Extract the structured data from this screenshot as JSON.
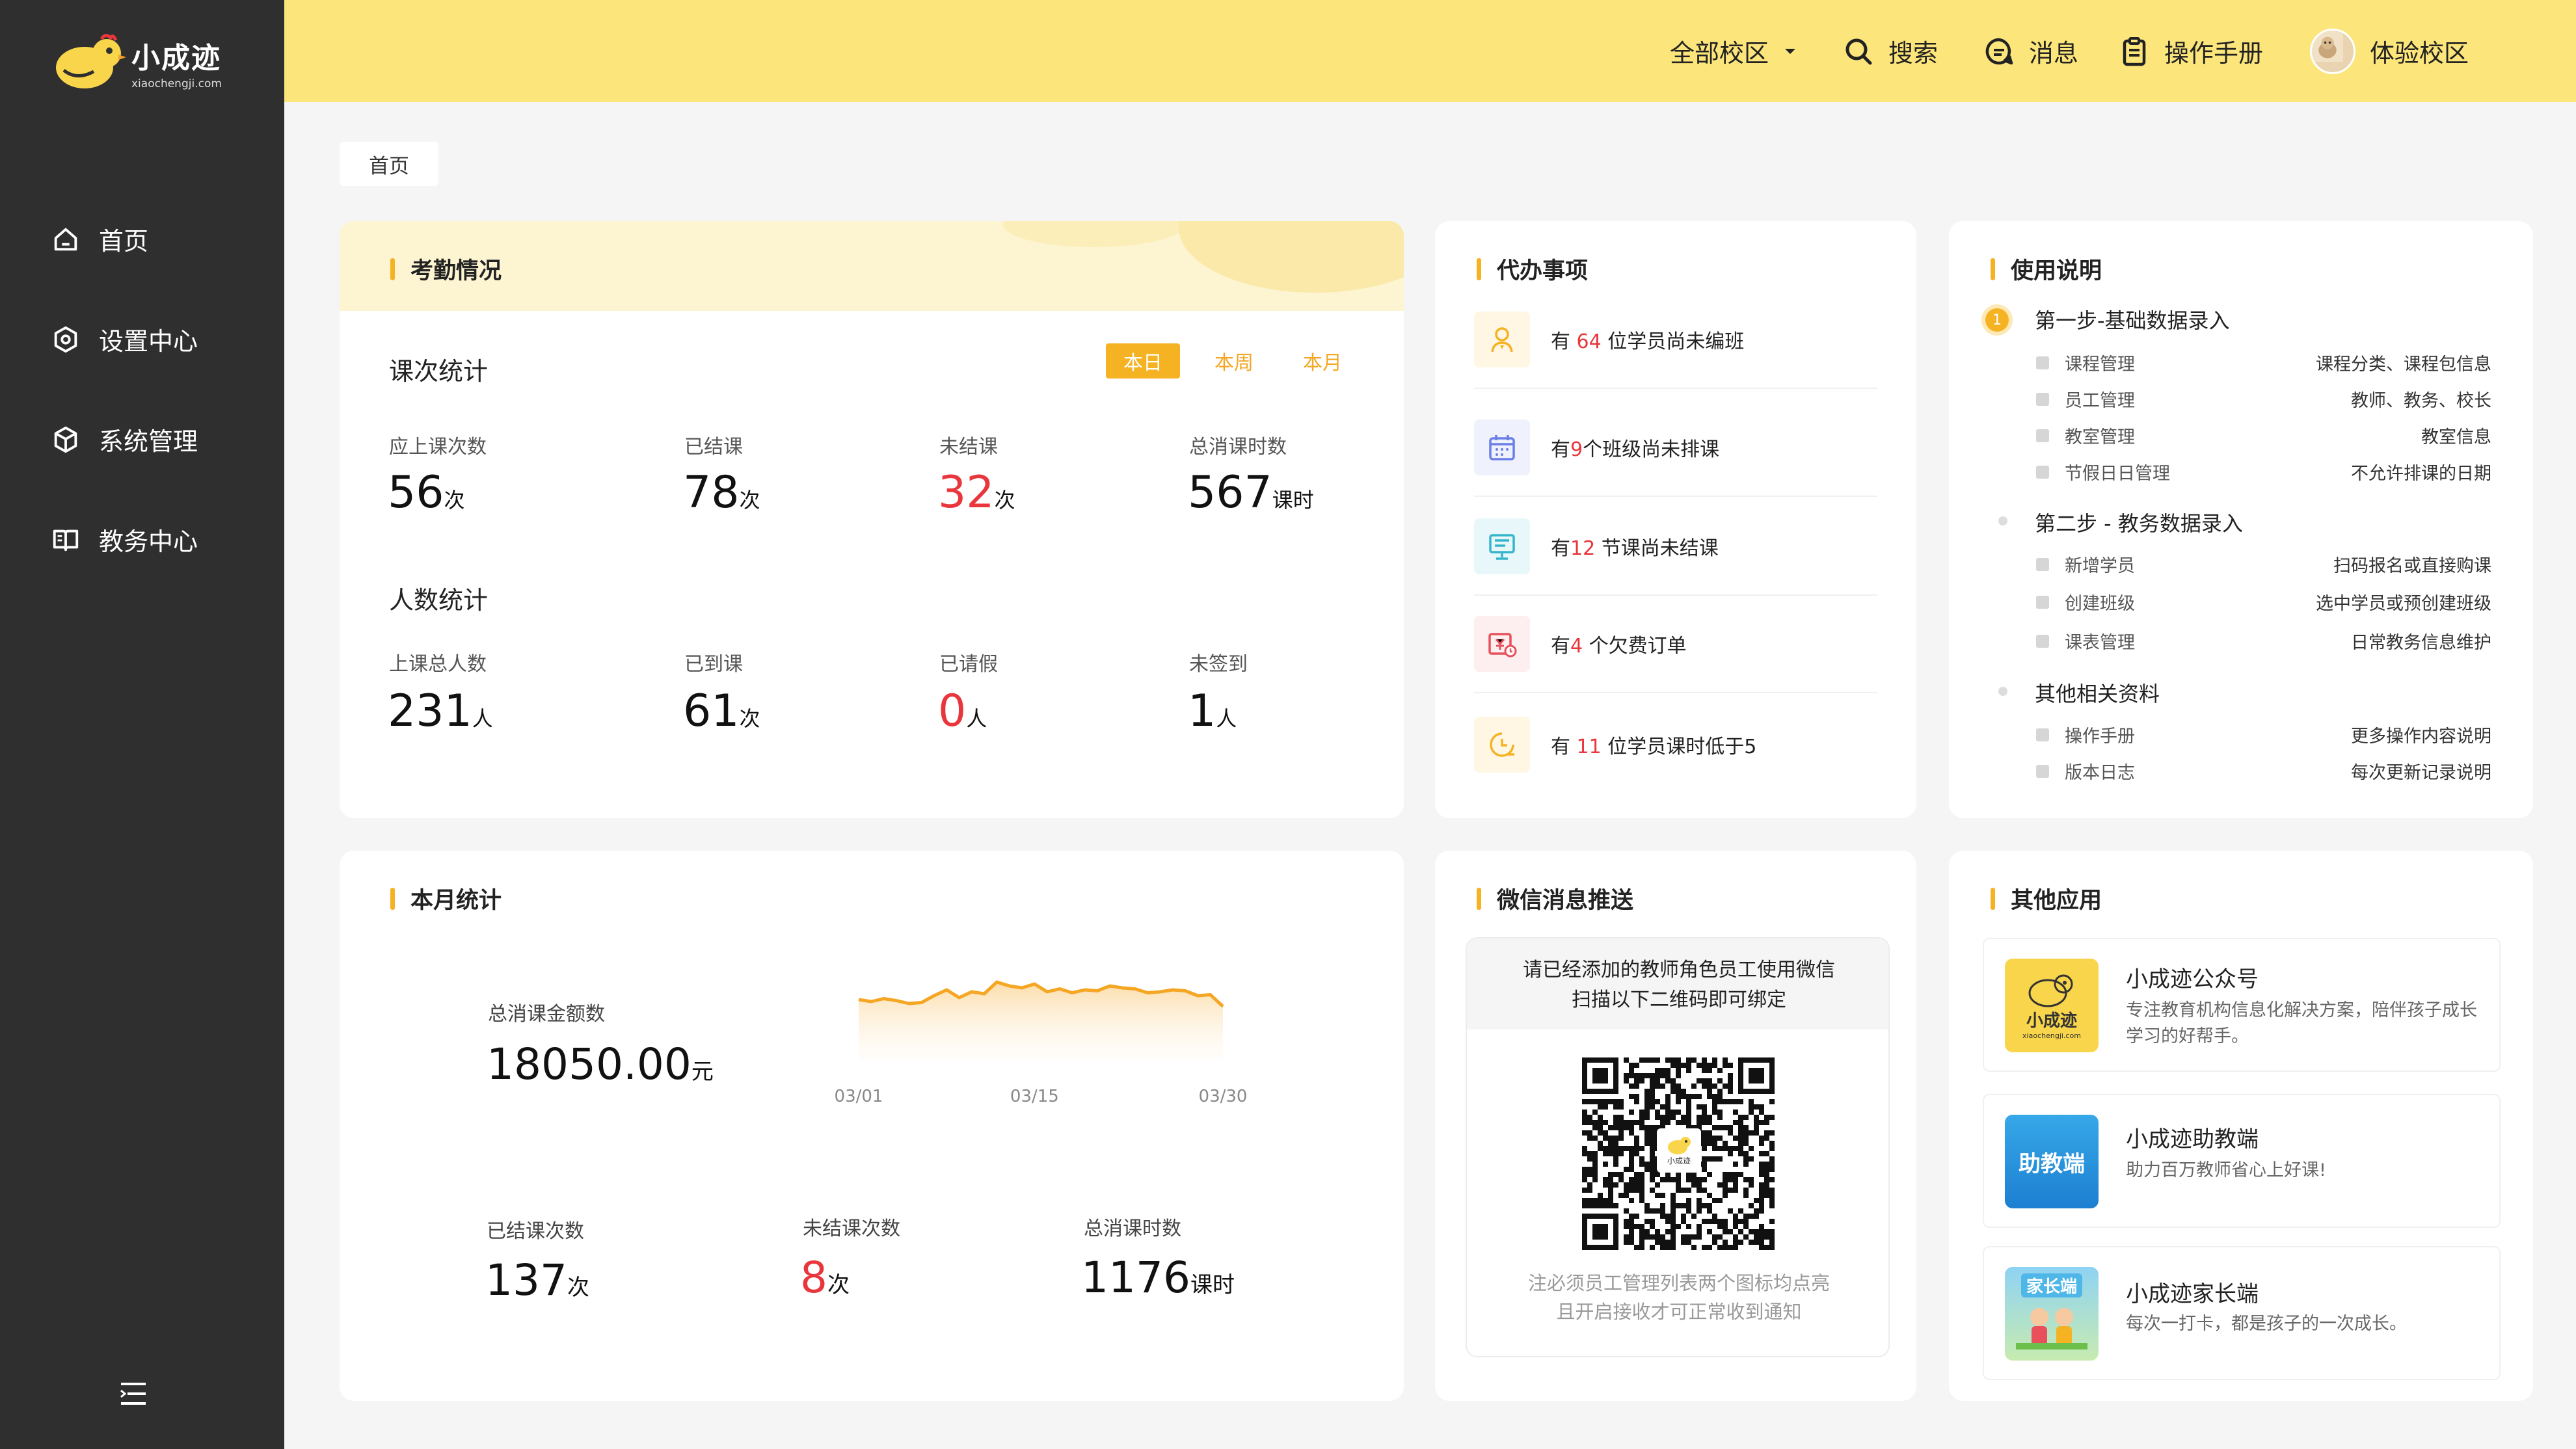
{
  "brand": {
    "name": "小成迹",
    "domain": "xiaochengji.com"
  },
  "nav": [
    {
      "label": "首页",
      "icon": "home-icon"
    },
    {
      "label": "设置中心",
      "icon": "settings-icon"
    },
    {
      "label": "系统管理",
      "icon": "cube-icon"
    },
    {
      "label": "教务中心",
      "icon": "book-icon"
    }
  ],
  "topbar": {
    "campus": "全部校区",
    "search": "搜索",
    "messages": "消息",
    "manual": "操作手册",
    "user": "体验校区"
  },
  "breadcrumb": "首页",
  "attendance": {
    "title": "考勤情况",
    "lesson_stats_title": "课次统计",
    "people_stats_title": "人数统计",
    "tabs": [
      "本日",
      "本周",
      "本月"
    ],
    "active_tab": "本日",
    "lessons": [
      {
        "label": "应上课次数",
        "value": "56",
        "unit": "次"
      },
      {
        "label": "已结课",
        "value": "78",
        "unit": "次"
      },
      {
        "label": "未结课",
        "value": "32",
        "unit": "次"
      },
      {
        "label": "总消课时数",
        "value": "567",
        "unit": "课时"
      }
    ],
    "people": [
      {
        "label": "上课总人数",
        "value": "231",
        "unit": "人"
      },
      {
        "label": "已到课",
        "value": "61",
        "unit": "次"
      },
      {
        "label": "已请假",
        "value": "0",
        "unit": "人"
      },
      {
        "label": "未签到",
        "value": "1",
        "unit": "人"
      }
    ]
  },
  "todo": {
    "title": "代办事项",
    "items": [
      {
        "pre": "有 ",
        "num": "64",
        "post": " 位学员尚未编班",
        "icon": "student-icon",
        "color": "#f5b324"
      },
      {
        "pre": "有",
        "num": "9",
        "post": "个班级尚未排课",
        "icon": "calendar-icon",
        "color": "#6c7ee8"
      },
      {
        "pre": "有",
        "num": "12",
        "post": " 节课尚未结课",
        "icon": "board-icon",
        "color": "#35b5c9"
      },
      {
        "pre": "有",
        "num": "4",
        "post": " 个欠费订单",
        "icon": "bill-icon",
        "color": "#e8505b"
      },
      {
        "pre": "有 ",
        "num": "11",
        "post": " 位学员课时低于5",
        "icon": "clock-icon",
        "color": "#f5b324"
      }
    ]
  },
  "guide": {
    "title": "使用说明",
    "steps": [
      {
        "title": "第一步-基础数据录入",
        "badge": "1",
        "lines": [
          {
            "left": "课程管理",
            "right": "课程分类、课程包信息"
          },
          {
            "left": "员工管理",
            "right": "教师、教务、校长"
          },
          {
            "left": "教室管理",
            "right": "教室信息"
          },
          {
            "left": "节假日日管理",
            "right": "不允许排课的日期"
          }
        ]
      },
      {
        "title": "第二步 - 教务数据录入",
        "lines": [
          {
            "left": "新增学员",
            "right": "扫码报名或直接购课"
          },
          {
            "left": "创建班级",
            "right": "选中学员或预创建班级"
          },
          {
            "left": "课表管理",
            "right": "日常教务信息维护"
          }
        ]
      },
      {
        "title": "其他相关资料",
        "lines": [
          {
            "left": "操作手册",
            "right": "更多操作内容说明"
          },
          {
            "left": "版本日志",
            "right": "每次更新记录说明"
          }
        ]
      }
    ]
  },
  "month": {
    "title": "本月统计",
    "amount_label": "总消课金额数",
    "amount_value": "18050.00",
    "amount_unit": "元",
    "stats": [
      {
        "label": "已结课次数",
        "value": "137",
        "unit": "次"
      },
      {
        "label": "未结课次数",
        "value": "8",
        "unit": "次"
      },
      {
        "label": "总消课时数",
        "value": "1176",
        "unit": "课时"
      }
    ]
  },
  "chart_data": {
    "type": "area",
    "x": [
      "03/01",
      "03/02",
      "03/03",
      "03/04",
      "03/05",
      "03/06",
      "03/07",
      "03/08",
      "03/09",
      "03/10",
      "03/11",
      "03/12",
      "03/13",
      "03/14",
      "03/15",
      "03/16",
      "03/17",
      "03/18",
      "03/19",
      "03/20",
      "03/21",
      "03/22",
      "03/23",
      "03/24",
      "03/25",
      "03/26",
      "03/27",
      "03/28",
      "03/29",
      "03/30"
    ],
    "tick_labels": [
      "03/01",
      "03/15",
      "03/30"
    ],
    "values": [
      62,
      60,
      63,
      61,
      58,
      59,
      66,
      72,
      64,
      70,
      68,
      80,
      76,
      74,
      78,
      70,
      73,
      69,
      72,
      71,
      76,
      74,
      73,
      69,
      70,
      72,
      71,
      66,
      67,
      55
    ],
    "title": "",
    "xlabel": "",
    "ylabel": "",
    "ylim": [
      0,
      100
    ],
    "grid": false,
    "color": "#f5a623"
  },
  "wechat": {
    "title": "微信消息推送",
    "head_line1": "请已经添加的教师角色员工使用微信",
    "head_line2": "扫描以下二维码即可绑定",
    "qr_label": "小成迹",
    "foot_line1": "注必须员工管理列表两个图标均点亮",
    "foot_line2": "且开启接收才可正常收到通知"
  },
  "apps": {
    "title": "其他应用",
    "items": [
      {
        "name": "小成迹公众号",
        "desc": "专注教育机构信息化解决方案，陪伴孩子成长学习的好帮手。",
        "icon_text": "小成迹",
        "icon_sub": "xiaochengji.com"
      },
      {
        "name": "小成迹助教端",
        "desc": "助力百万教师省心上好课!",
        "icon_text": "助教端"
      },
      {
        "name": "小成迹家长端",
        "desc": "每次一打卡，都是孩子的一次成长。",
        "icon_text": "家长端"
      }
    ]
  }
}
